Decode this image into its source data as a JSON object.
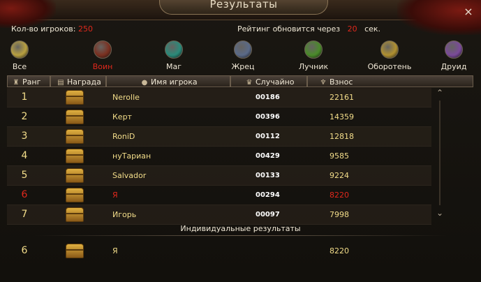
{
  "window": {
    "title": "Результаты",
    "close_icon": "×"
  },
  "info": {
    "players_label": "Кол-во игроков:",
    "players_count": "250",
    "rating_label": "Рейтинг обновится через",
    "rating_seconds": "20",
    "seconds_label": "сек."
  },
  "classes": [
    {
      "label": "Все",
      "color": "#b8a040",
      "active": false
    },
    {
      "label": "Воин",
      "color": "#7a3020",
      "active": true
    },
    {
      "label": "Маг",
      "color": "#2a8a7a",
      "active": false
    },
    {
      "label": "Жрец",
      "color": "#5a6a88",
      "active": false
    },
    {
      "label": "Лучник",
      "color": "#4a8a2a",
      "active": false
    },
    {
      "label": "Оборотень",
      "color": "#b09030",
      "active": false
    },
    {
      "label": "Друид",
      "color": "#7a4a9a",
      "active": false
    }
  ],
  "columns": {
    "rank": "Ранг",
    "reward": "Награда",
    "player": "Имя игрока",
    "random": "Случайно",
    "contribution": "Взнос"
  },
  "rows": [
    {
      "rank": "1",
      "name": "Nerolle",
      "random": "00186",
      "contribution": "22161",
      "me": false
    },
    {
      "rank": "2",
      "name": "Керт",
      "random": "00396",
      "contribution": "14359",
      "me": false
    },
    {
      "rank": "3",
      "name": "RoniD",
      "random": "00112",
      "contribution": "12818",
      "me": false
    },
    {
      "rank": "4",
      "name": "нуТариан",
      "random": "00429",
      "contribution": "9585",
      "me": false
    },
    {
      "rank": "5",
      "name": "Salvador",
      "random": "00133",
      "contribution": "9224",
      "me": false
    },
    {
      "rank": "6",
      "name": "Я",
      "random": "00294",
      "contribution": "8220",
      "me": true
    },
    {
      "rank": "7",
      "name": "Игорь",
      "random": "00097",
      "contribution": "7998",
      "me": false
    }
  ],
  "individual": {
    "title": "Индивидуальные результаты",
    "rank": "6",
    "name": "Я",
    "contribution": "8220"
  },
  "colors": {
    "accent_red": "#e0281c",
    "gold_text": "#f3dd8a"
  }
}
